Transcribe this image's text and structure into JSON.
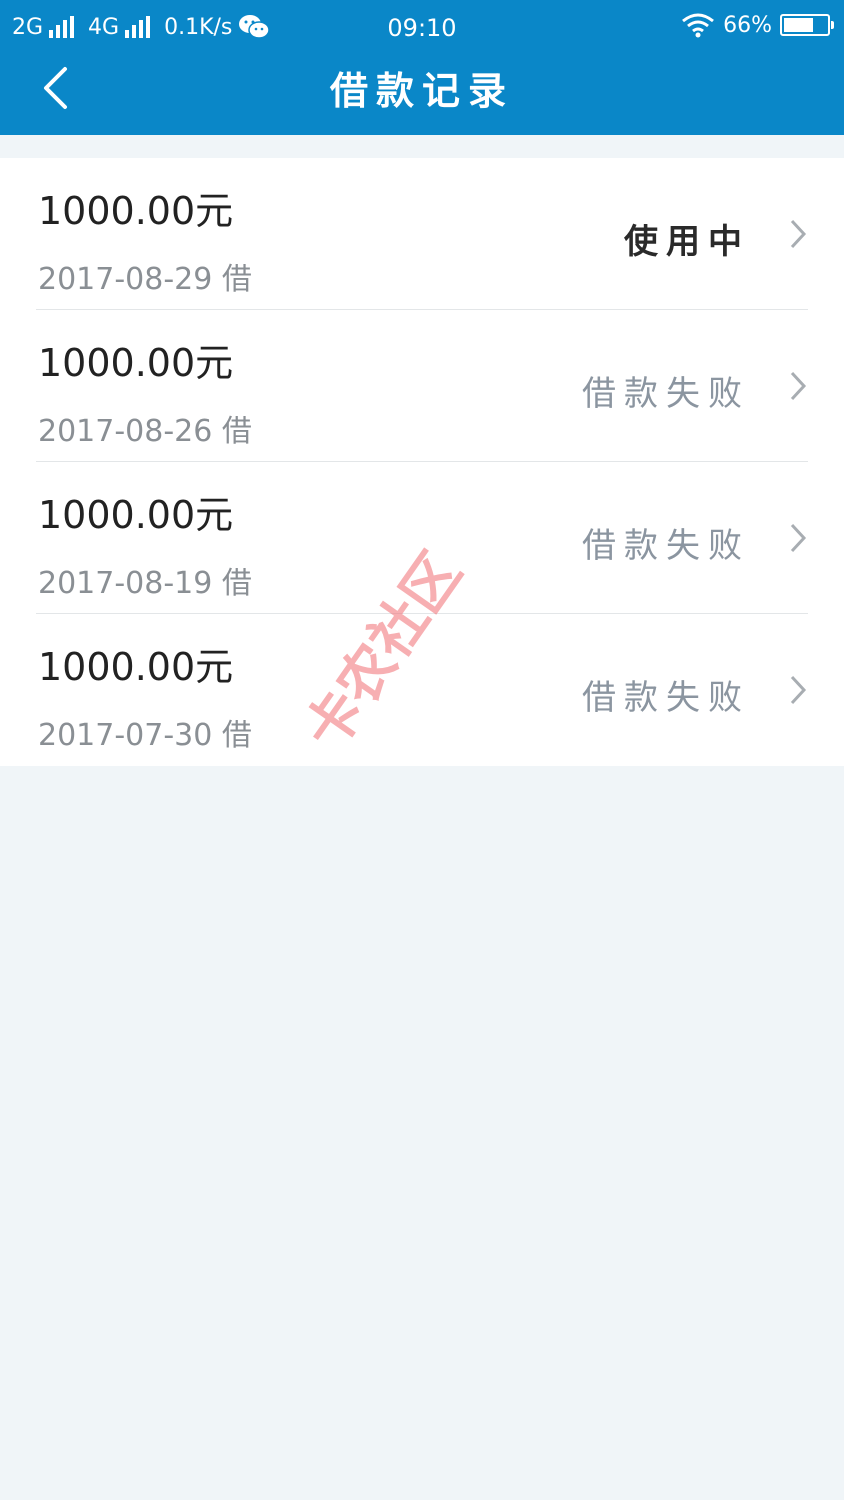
{
  "status_bar": {
    "sim1": "2G",
    "sim2": "4G",
    "net_speed": "0.1K/s",
    "time": "09:10",
    "battery": "66%"
  },
  "nav": {
    "title": "借款记录"
  },
  "loans": [
    {
      "amount": "1000.00元",
      "date": "2017-08-29 借",
      "status": "使用中"
    },
    {
      "amount": "1000.00元",
      "date": "2017-08-26 借",
      "status": "借款失败"
    },
    {
      "amount": "1000.00元",
      "date": "2017-08-19 借",
      "status": "借款失败"
    },
    {
      "amount": "1000.00元",
      "date": "2017-07-30 借",
      "status": "借款失败"
    }
  ],
  "watermark": "卡农社区",
  "icons": [
    "signal-icon",
    "wechat-icon",
    "wifi-icon",
    "battery-icon",
    "back-arrow-icon",
    "chevron-right-icon"
  ],
  "colors": {
    "header": "#0a87c8",
    "background": "#f0f5f8",
    "status_active": "#2a2a2a",
    "status_failed": "#8b95a0",
    "watermark": "#f06e73"
  }
}
